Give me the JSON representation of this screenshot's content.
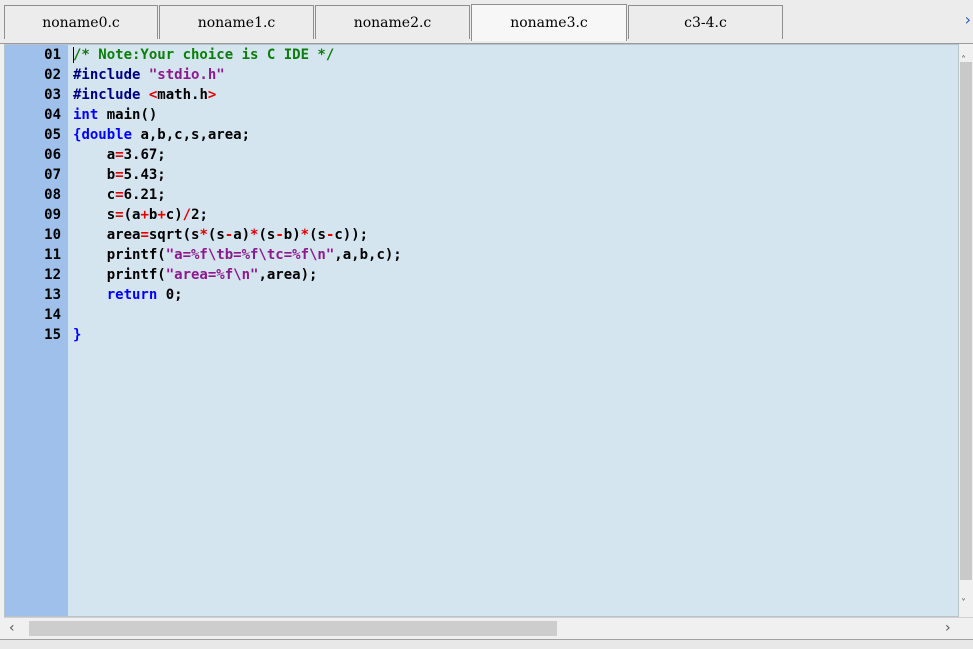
{
  "tabs": [
    {
      "label": "noname0.c"
    },
    {
      "label": "noname1.c"
    },
    {
      "label": "noname2.c"
    },
    {
      "label": "noname3.c"
    },
    {
      "label": "c3-4.c"
    }
  ],
  "active_tab": "noname3.c",
  "tab_scroll_icon": "chevron-right-icon",
  "code_lines": [
    {
      "n": "01",
      "parts": [
        {
          "t": "/* Note:Your choice is C IDE */",
          "c": "comment"
        }
      ]
    },
    {
      "n": "02",
      "parts": [
        {
          "t": "#include ",
          "c": "pp"
        },
        {
          "t": "\"stdio.h\"",
          "c": "str"
        }
      ]
    },
    {
      "n": "03",
      "parts": [
        {
          "t": "#include ",
          "c": "pp"
        },
        {
          "t": "<",
          "c": "red"
        },
        {
          "t": "math.h",
          "c": ""
        },
        {
          "t": ">",
          "c": "red"
        }
      ]
    },
    {
      "n": "04",
      "parts": [
        {
          "t": "int",
          "c": "kw"
        },
        {
          "t": " main()",
          "c": ""
        }
      ]
    },
    {
      "n": "05",
      "parts": [
        {
          "t": "{",
          "c": "kw"
        },
        {
          "t": "double",
          "c": "kw"
        },
        {
          "t": " a,b,c,s,area;",
          "c": ""
        }
      ]
    },
    {
      "n": "06",
      "parts": [
        {
          "t": "    a",
          "c": ""
        },
        {
          "t": "=",
          "c": "red"
        },
        {
          "t": "3.67;",
          "c": ""
        }
      ]
    },
    {
      "n": "07",
      "parts": [
        {
          "t": "    b",
          "c": ""
        },
        {
          "t": "=",
          "c": "red"
        },
        {
          "t": "5.43;",
          "c": ""
        }
      ]
    },
    {
      "n": "08",
      "parts": [
        {
          "t": "    c",
          "c": ""
        },
        {
          "t": "=",
          "c": "red"
        },
        {
          "t": "6.21;",
          "c": ""
        }
      ]
    },
    {
      "n": "09",
      "parts": [
        {
          "t": "    s",
          "c": ""
        },
        {
          "t": "=",
          "c": "red"
        },
        {
          "t": "(a",
          "c": ""
        },
        {
          "t": "+",
          "c": "red"
        },
        {
          "t": "b",
          "c": ""
        },
        {
          "t": "+",
          "c": "red"
        },
        {
          "t": "c)",
          "c": ""
        },
        {
          "t": "/",
          "c": "red"
        },
        {
          "t": "2;",
          "c": ""
        }
      ]
    },
    {
      "n": "10",
      "parts": [
        {
          "t": "    area",
          "c": ""
        },
        {
          "t": "=",
          "c": "red"
        },
        {
          "t": "sqrt(s",
          "c": ""
        },
        {
          "t": "*",
          "c": "red"
        },
        {
          "t": "(s",
          "c": ""
        },
        {
          "t": "-",
          "c": "red"
        },
        {
          "t": "a)",
          "c": ""
        },
        {
          "t": "*",
          "c": "red"
        },
        {
          "t": "(s",
          "c": ""
        },
        {
          "t": "-",
          "c": "red"
        },
        {
          "t": "b)",
          "c": ""
        },
        {
          "t": "*",
          "c": "red"
        },
        {
          "t": "(s",
          "c": ""
        },
        {
          "t": "-",
          "c": "red"
        },
        {
          "t": "c));",
          "c": ""
        }
      ]
    },
    {
      "n": "11",
      "parts": [
        {
          "t": "    printf(",
          "c": ""
        },
        {
          "t": "\"a=%f\\tb=%f\\tc=%f\\n\"",
          "c": "str"
        },
        {
          "t": ",a,b,c);",
          "c": ""
        }
      ]
    },
    {
      "n": "12",
      "parts": [
        {
          "t": "    printf(",
          "c": ""
        },
        {
          "t": "\"area=%f\\n\"",
          "c": "str"
        },
        {
          "t": ",area);",
          "c": ""
        }
      ]
    },
    {
      "n": "13",
      "parts": [
        {
          "t": "    ",
          "c": ""
        },
        {
          "t": "return",
          "c": "kw"
        },
        {
          "t": " 0;",
          "c": ""
        }
      ]
    },
    {
      "n": "14",
      "parts": []
    },
    {
      "n": "15",
      "parts": [
        {
          "t": "}",
          "c": "kw"
        }
      ]
    }
  ],
  "scroll_icons": {
    "up": "chevron-up-icon",
    "down": "chevron-down-icon",
    "left": "chevron-left-icon",
    "right": "chevron-right-icon"
  }
}
